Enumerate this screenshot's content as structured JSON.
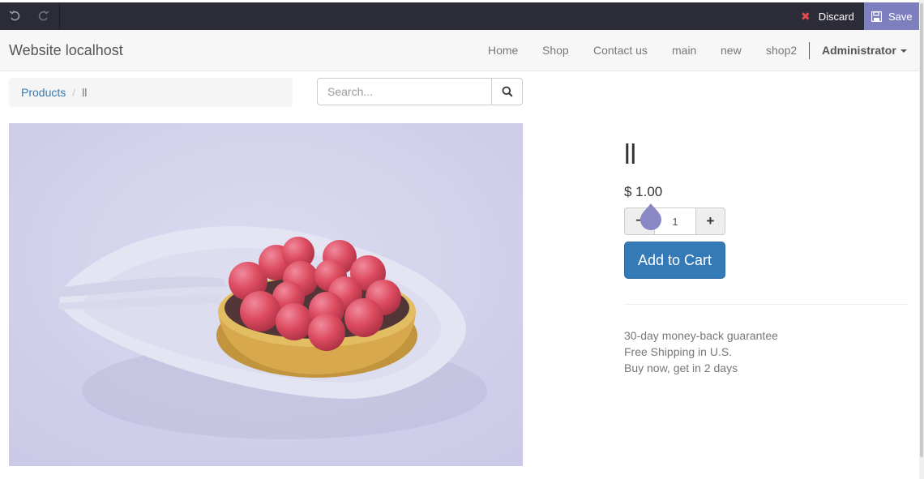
{
  "editor": {
    "discard_label": "Discard",
    "save_label": "Save",
    "accent_color": "#7e7fbf"
  },
  "navbar": {
    "brand": "Website localhost",
    "items": [
      {
        "label": "Home"
      },
      {
        "label": "Shop"
      },
      {
        "label": "Contact us"
      },
      {
        "label": "main"
      },
      {
        "label": "new"
      },
      {
        "label": "shop2"
      }
    ],
    "user": "Administrator"
  },
  "breadcrumb": {
    "items": [
      {
        "label": "Products",
        "link": true
      },
      {
        "label": "ll",
        "link": false
      }
    ]
  },
  "search": {
    "placeholder": "Search..."
  },
  "product": {
    "name": "ll",
    "price": "$ 1.00",
    "quantity": "1",
    "add_to_cart_label": "Add to Cart",
    "benefits": [
      "30-day money-back guarantee",
      "Free Shipping in U.S.",
      "Buy now, get in 2 days"
    ]
  },
  "icons": {
    "undo": "undo-icon",
    "redo": "redo-icon",
    "discard": "close-icon",
    "save": "floppy-disk-icon",
    "search": "search-icon"
  }
}
